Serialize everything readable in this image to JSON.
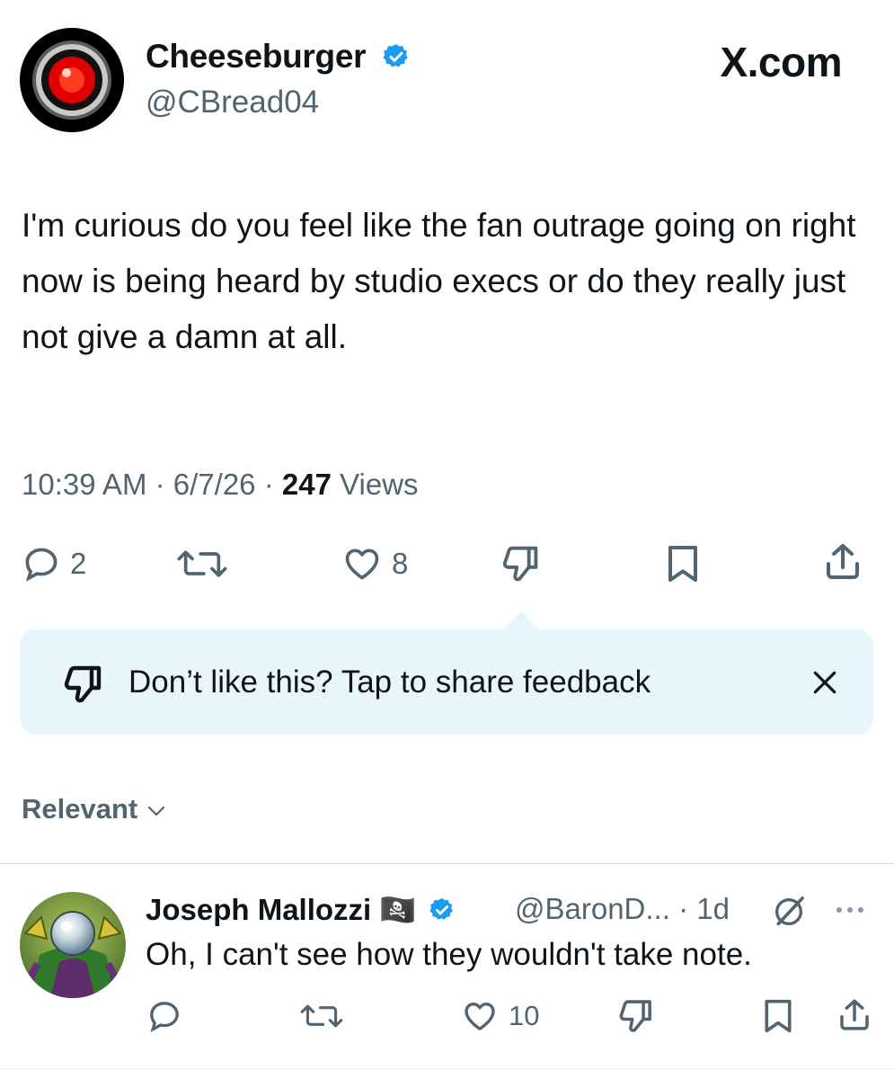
{
  "colors": {
    "accent": "#1d9bf0",
    "muted": "#536471",
    "text": "#0f1419",
    "feedback_bg": "#e8f5fd"
  },
  "tweet": {
    "author": {
      "display_name": "Cheeseburger",
      "handle": "@CBread04",
      "verified": true,
      "avatar": "red-eye-avatar"
    },
    "brand": "X.com",
    "text": "I'm curious do you feel like the fan outrage going on right now is being heard by studio execs or do they really just not give a damn at all.",
    "time": "10:39 AM",
    "date": "6/7/26",
    "views_count": "247",
    "views_label": "Views",
    "sep": "·",
    "actions": {
      "replies": "2",
      "likes": "8"
    }
  },
  "feedback": {
    "text": "Don’t like this? Tap to share feedback",
    "close_icon": "close-icon"
  },
  "sort": {
    "label": "Relevant"
  },
  "reply": {
    "display_name": "Joseph Mallozzi",
    "flag": "🏴‍☠️",
    "handle": "@BaronD...",
    "time": "· 1d",
    "text": "Oh, I can't see how they wouldn't take note.",
    "actions": {
      "likes": "10"
    }
  }
}
